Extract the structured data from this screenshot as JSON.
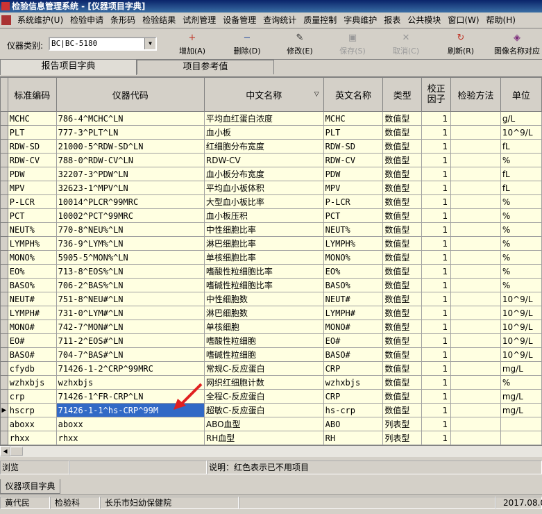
{
  "window": {
    "title": "检验信息管理系统 - [仪器项目字典]"
  },
  "menu": [
    "系统维护(U)",
    "检验申请",
    "条形码",
    "检验结果",
    "试剂管理",
    "设备管理",
    "查询统计",
    "质量控制",
    "字典维护",
    "报表",
    "公共模块",
    "窗口(W)",
    "帮助(H)"
  ],
  "toolbar": {
    "instrument_label": "仪器类别:",
    "instrument_value": "BC|BC-5180",
    "buttons": [
      {
        "label": "增加(A)",
        "icon": "add-icon",
        "enabled": true
      },
      {
        "label": "删除(D)",
        "icon": "delete-icon",
        "enabled": true
      },
      {
        "label": "修改(E)",
        "icon": "edit-icon",
        "enabled": true
      },
      {
        "label": "保存(S)",
        "icon": "save-icon",
        "enabled": false
      },
      {
        "label": "取消(C)",
        "icon": "cancel-icon",
        "enabled": false
      },
      {
        "label": "刷新(R)",
        "icon": "refresh-icon",
        "enabled": true
      },
      {
        "label": "图像名称对应",
        "icon": "image-map-icon",
        "enabled": true
      }
    ]
  },
  "tabs": [
    {
      "label": "报告项目字典"
    },
    {
      "label": "项目参考值"
    }
  ],
  "table": {
    "columns": [
      "标准编码",
      "仪器代码",
      "中文名称",
      "英文名称",
      "类型",
      "校正因子",
      "检验方法",
      "单位"
    ],
    "rows": [
      [
        "MCHC",
        "786-4^MCHC^LN",
        "平均血红蛋白浓度",
        "MCHC",
        "数值型",
        "1",
        "",
        "g/L"
      ],
      [
        "PLT",
        "777-3^PLT^LN",
        "血小板",
        "PLT",
        "数值型",
        "1",
        "",
        "10^9/L"
      ],
      [
        "RDW-SD",
        "21000-5^RDW-SD^LN",
        "红细胞分布宽度",
        "RDW-SD",
        "数值型",
        "1",
        "",
        "fL"
      ],
      [
        "RDW-CV",
        "788-0^RDW-CV^LN",
        "RDW-CV",
        "RDW-CV",
        "数值型",
        "1",
        "",
        "%"
      ],
      [
        "PDW",
        "32207-3^PDW^LN",
        "血小板分布宽度",
        "PDW",
        "数值型",
        "1",
        "",
        "fL"
      ],
      [
        "MPV",
        "32623-1^MPV^LN",
        "平均血小板体积",
        "MPV",
        "数值型",
        "1",
        "",
        "fL"
      ],
      [
        "P-LCR",
        "10014^PLCR^99MRC",
        "大型血小板比率",
        "P-LCR",
        "数值型",
        "1",
        "",
        "%"
      ],
      [
        "PCT",
        "10002^PCT^99MRC",
        "血小板压积",
        "PCT",
        "数值型",
        "1",
        "",
        "%"
      ],
      [
        "NEUT%",
        "770-8^NEU%^LN",
        "中性细胞比率",
        "NEUT%",
        "数值型",
        "1",
        "",
        "%"
      ],
      [
        "LYMPH%",
        "736-9^LYM%^LN",
        "淋巴细胞比率",
        "LYMPH%",
        "数值型",
        "1",
        "",
        "%"
      ],
      [
        "MONO%",
        "5905-5^MON%^LN",
        "单核细胞比率",
        "MONO%",
        "数值型",
        "1",
        "",
        "%"
      ],
      [
        "EO%",
        "713-8^EOS%^LN",
        "嗜酸性粒细胞比率",
        "EO%",
        "数值型",
        "1",
        "",
        "%"
      ],
      [
        "BASO%",
        "706-2^BAS%^LN",
        "嗜碱性粒细胞比率",
        "BASO%",
        "数值型",
        "1",
        "",
        "%"
      ],
      [
        "NEUT#",
        "751-8^NEU#^LN",
        "中性细胞数",
        "NEUT#",
        "数值型",
        "1",
        "",
        "10^9/L"
      ],
      [
        "LYMPH#",
        "731-0^LYM#^LN",
        "淋巴细胞数",
        "LYMPH#",
        "数值型",
        "1",
        "",
        "10^9/L"
      ],
      [
        "MONO#",
        "742-7^MON#^LN",
        "单核细胞",
        "MONO#",
        "数值型",
        "1",
        "",
        "10^9/L"
      ],
      [
        "EO#",
        "711-2^EOS#^LN",
        "嗜酸性粒细胞",
        "EO#",
        "数值型",
        "1",
        "",
        "10^9/L"
      ],
      [
        "BASO#",
        "704-7^BAS#^LN",
        "嗜碱性粒细胞",
        "BASO#",
        "数值型",
        "1",
        "",
        "10^9/L"
      ],
      [
        "cfydb",
        "71426-1-2^CRP^99MRC",
        "常规C-反应蛋白",
        "CRP",
        "数值型",
        "1",
        "",
        "mg/L"
      ],
      [
        "wzhxbjs",
        "wzhxbjs",
        "网织红细胞计数",
        "wzhxbjs",
        "数值型",
        "1",
        "",
        "%"
      ],
      [
        "crp",
        "71426-1^FR-CRP^LN",
        "全程C-反应蛋白",
        "CRP",
        "数值型",
        "1",
        "",
        "mg/L"
      ],
      [
        "hscrp",
        "71426-1-1^hs-CRP^99M",
        "超敏C-反应蛋白",
        "hs-crp",
        "数值型",
        "1",
        "",
        "mg/L"
      ],
      [
        "aboxx",
        "aboxx",
        "ABO血型",
        "ABO",
        "列表型",
        "1",
        "",
        ""
      ],
      [
        "rhxx",
        "rhxx",
        "RH血型",
        "RH",
        "列表型",
        "1",
        "",
        ""
      ]
    ],
    "selected_row": 21
  },
  "status": {
    "mode": "浏览",
    "note": "说明：红色表示已不用项目"
  },
  "bottom_tab": "仪器项目字典",
  "footer": {
    "user": "黄代民",
    "dept": "检验科",
    "hospital": "长乐市妇幼保健院",
    "date": "2017.08.0"
  },
  "colors": {
    "title_bar": "#0a246a",
    "selection": "#3169c6",
    "row_bg": "#ffffe1",
    "annotation": "#e02020"
  }
}
